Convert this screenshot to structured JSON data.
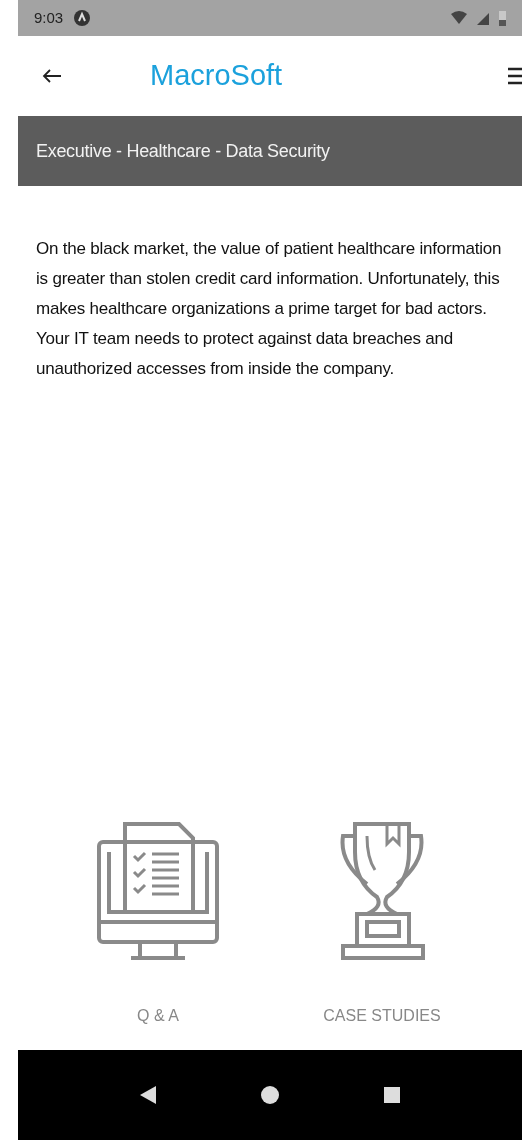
{
  "status_bar": {
    "time": "9:03"
  },
  "app_bar": {
    "title": "MacroSoft"
  },
  "breadcrumb": "Executive - Healthcare - Data Security",
  "body": "On the black market, the value of patient healthcare information is greater than stolen credit card information. Unfortunately, this makes healthcare organizations a prime target for bad actors. Your IT team needs to protect against data breaches and unauthorized accesses from inside the company.",
  "tiles": [
    {
      "kind": "checklist",
      "label": "Q & A"
    },
    {
      "kind": "trophy",
      "label": "CASE STUDIES"
    }
  ]
}
